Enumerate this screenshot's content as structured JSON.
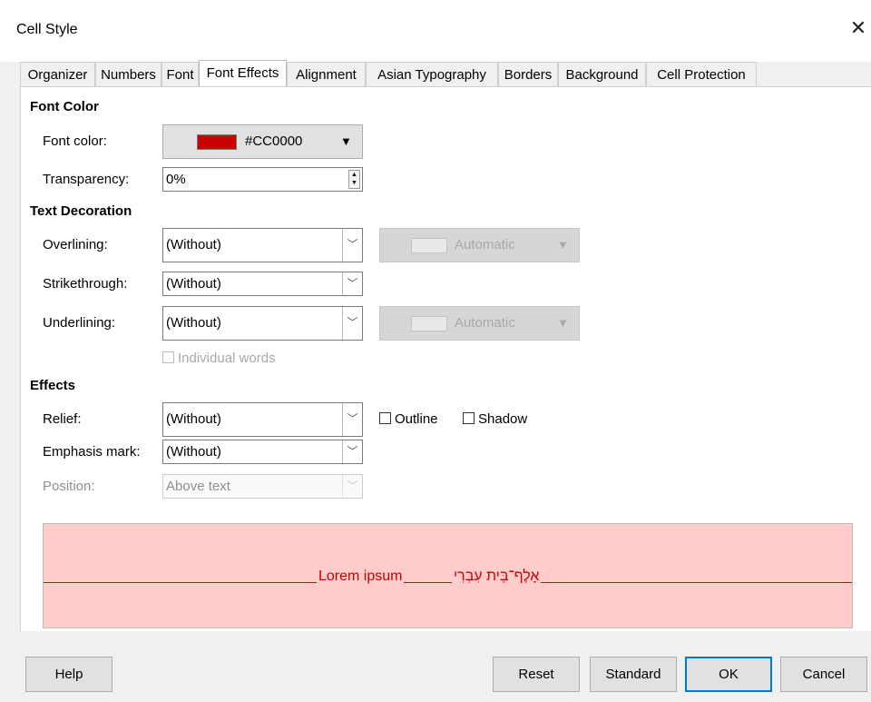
{
  "window": {
    "title": "Cell Style",
    "close_glyph": "✕"
  },
  "tabs": [
    "Organizer",
    "Numbers",
    "Font",
    "Font Effects",
    "Alignment",
    "Asian Typography",
    "Borders",
    "Background",
    "Cell Protection"
  ],
  "active_tab": "Font Effects",
  "font_color": {
    "heading": "Font Color",
    "color_label": "Font color:",
    "color_value": "#CC0000",
    "swatch_color": "#cc0000",
    "transparency_label": "Transparency:",
    "transparency_value": "0%"
  },
  "text_decoration": {
    "heading": "Text Decoration",
    "overlining_label": "Overlining:",
    "overlining_value": "(Without)",
    "overlining_color": "Automatic",
    "strikethrough_label": "Strikethrough:",
    "strikethrough_value": "(Without)",
    "underlining_label": "Underlining:",
    "underlining_value": "(Without)",
    "underlining_color": "Automatic",
    "individual_words": "Individual words"
  },
  "effects": {
    "heading": "Effects",
    "relief_label": "Relief:",
    "relief_value": "(Without)",
    "outline": "Outline",
    "shadow": "Shadow",
    "emphasis_label": "Emphasis mark:",
    "emphasis_value": "(Without)",
    "position_label": "Position:",
    "position_value": "Above text"
  },
  "preview": {
    "latin": "Lorem ipsum",
    "hebrew": "אָלֶף־בֵּית עִבְרִי",
    "text_color": "#cc0000",
    "bg_color": "#ffcccc"
  },
  "buttons": {
    "help": "Help",
    "reset": "Reset",
    "standard": "Standard",
    "ok": "OK",
    "cancel": "Cancel"
  }
}
